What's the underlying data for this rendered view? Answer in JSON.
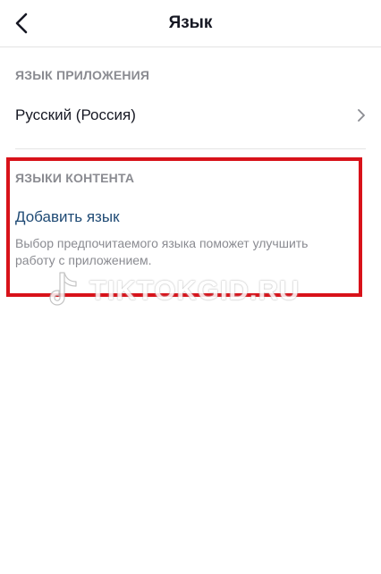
{
  "header": {
    "title": "Язык",
    "back_icon": "chevron-left-icon"
  },
  "app_language": {
    "section_title": "ЯЗЫК ПРИЛОЖЕНИЯ",
    "selected_label": "Русский (Россия)",
    "chevron_icon": "chevron-right-icon"
  },
  "content_language": {
    "section_title": "ЯЗЫКИ КОНТЕНТА",
    "add_link_label": "Добавить язык",
    "hint": "Выбор предпочитаемого языка поможет улучшить работу с приложением."
  },
  "watermark": {
    "text": "TIKTOKGID.RU",
    "icon": "music-note-logo-icon"
  },
  "colors": {
    "highlight": "#d8121a",
    "link": "#204b75",
    "muted": "#8a8b91",
    "text": "#161823"
  }
}
